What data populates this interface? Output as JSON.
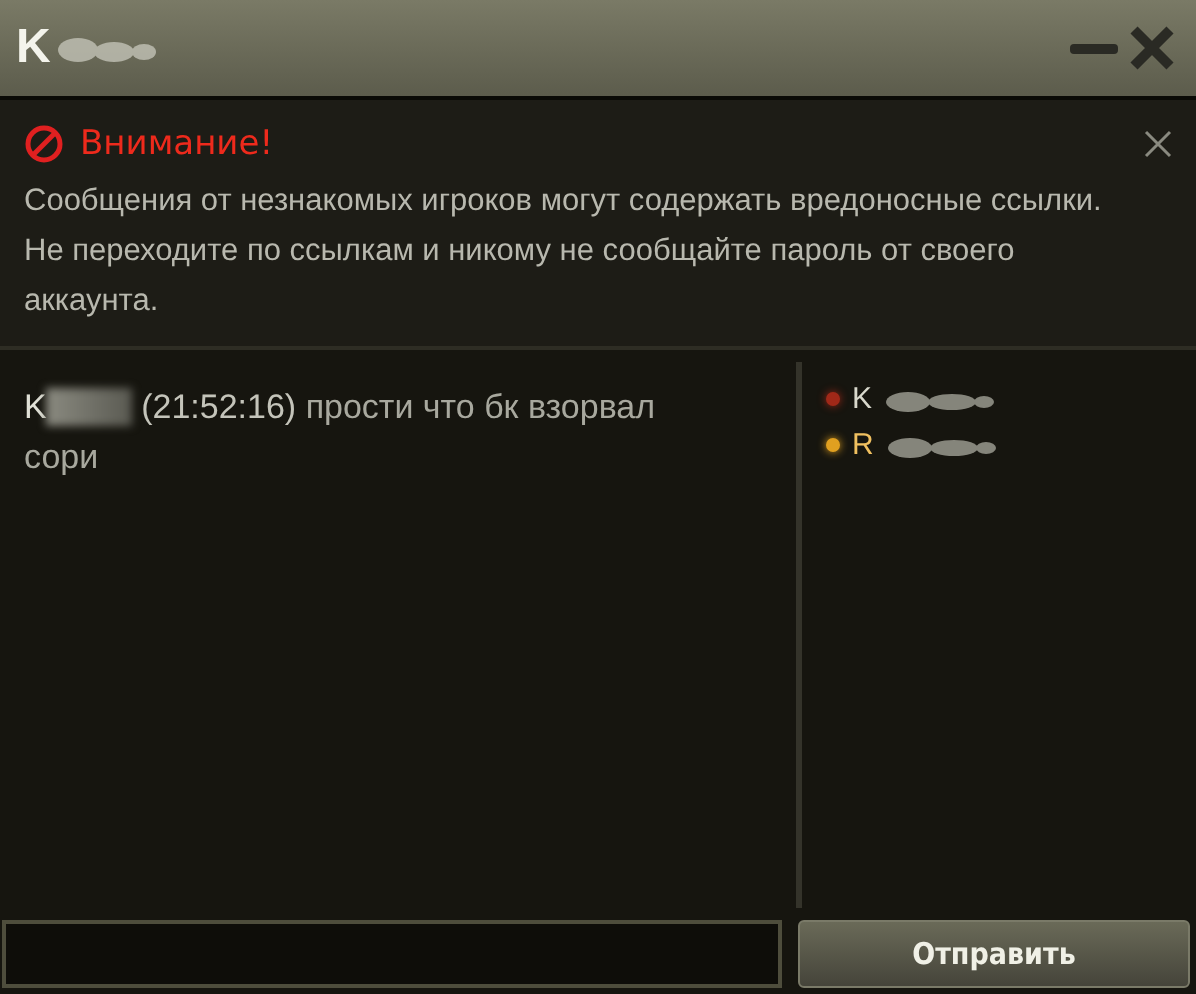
{
  "window": {
    "title": "K"
  },
  "warning": {
    "heading": "Внимание!",
    "text": "Сообщения от незнакомых игроков могут содержать вредоносные ссылки. Не переходите по ссылкам и никому не сообщайте пароль от своего аккаунта."
  },
  "messages": [
    {
      "sender": "K",
      "time": "(21:52:16)",
      "text": "прости что бк взорвал сори"
    }
  ],
  "members": [
    {
      "name": "K",
      "color": "#a02818"
    },
    {
      "name": "R",
      "color": "#e0a020"
    }
  ],
  "composer": {
    "send_label": "Отправить"
  }
}
